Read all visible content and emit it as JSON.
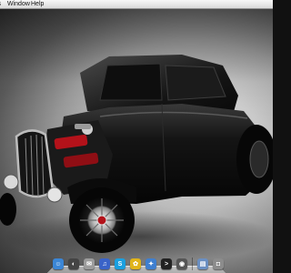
{
  "menubar": {
    "items": [
      "Window",
      "Help"
    ],
    "clipped_item": "ls"
  },
  "wallpaper": {
    "subject": "black hot rod coupe",
    "colors": {
      "body": "#121212",
      "engine_red": "#b3121a",
      "chrome": "#d8d8d8",
      "background_light": "#e6e6e6",
      "background_dark": "#2a2a2a"
    }
  },
  "dock": {
    "icons": [
      {
        "name": "finder-icon",
        "glyph": "☺",
        "color": "#3b86d6"
      },
      {
        "name": "dashboard-icon",
        "glyph": "◐",
        "color": "#444444"
      },
      {
        "name": "mail-icon",
        "glyph": "✉",
        "color": "#9c9c9c"
      },
      {
        "name": "itunes-icon",
        "glyph": "♫",
        "color": "#3a63c8"
      },
      {
        "name": "skype-icon",
        "glyph": "S",
        "color": "#1aa0e0"
      },
      {
        "name": "sunflower-icon",
        "glyph": "✿",
        "color": "#e0b41a"
      },
      {
        "name": "safari-icon",
        "glyph": "✦",
        "color": "#3f7fd0"
      },
      {
        "name": "terminal-icon",
        "glyph": ">",
        "color": "#222222"
      },
      {
        "name": "camera-icon",
        "glyph": "◉",
        "color": "#555555"
      },
      {
        "name": "folder-icon",
        "glyph": "▤",
        "color": "#6a8fc2"
      },
      {
        "name": "trash-icon",
        "glyph": "◘",
        "color": "#8c8c8c"
      }
    ]
  }
}
